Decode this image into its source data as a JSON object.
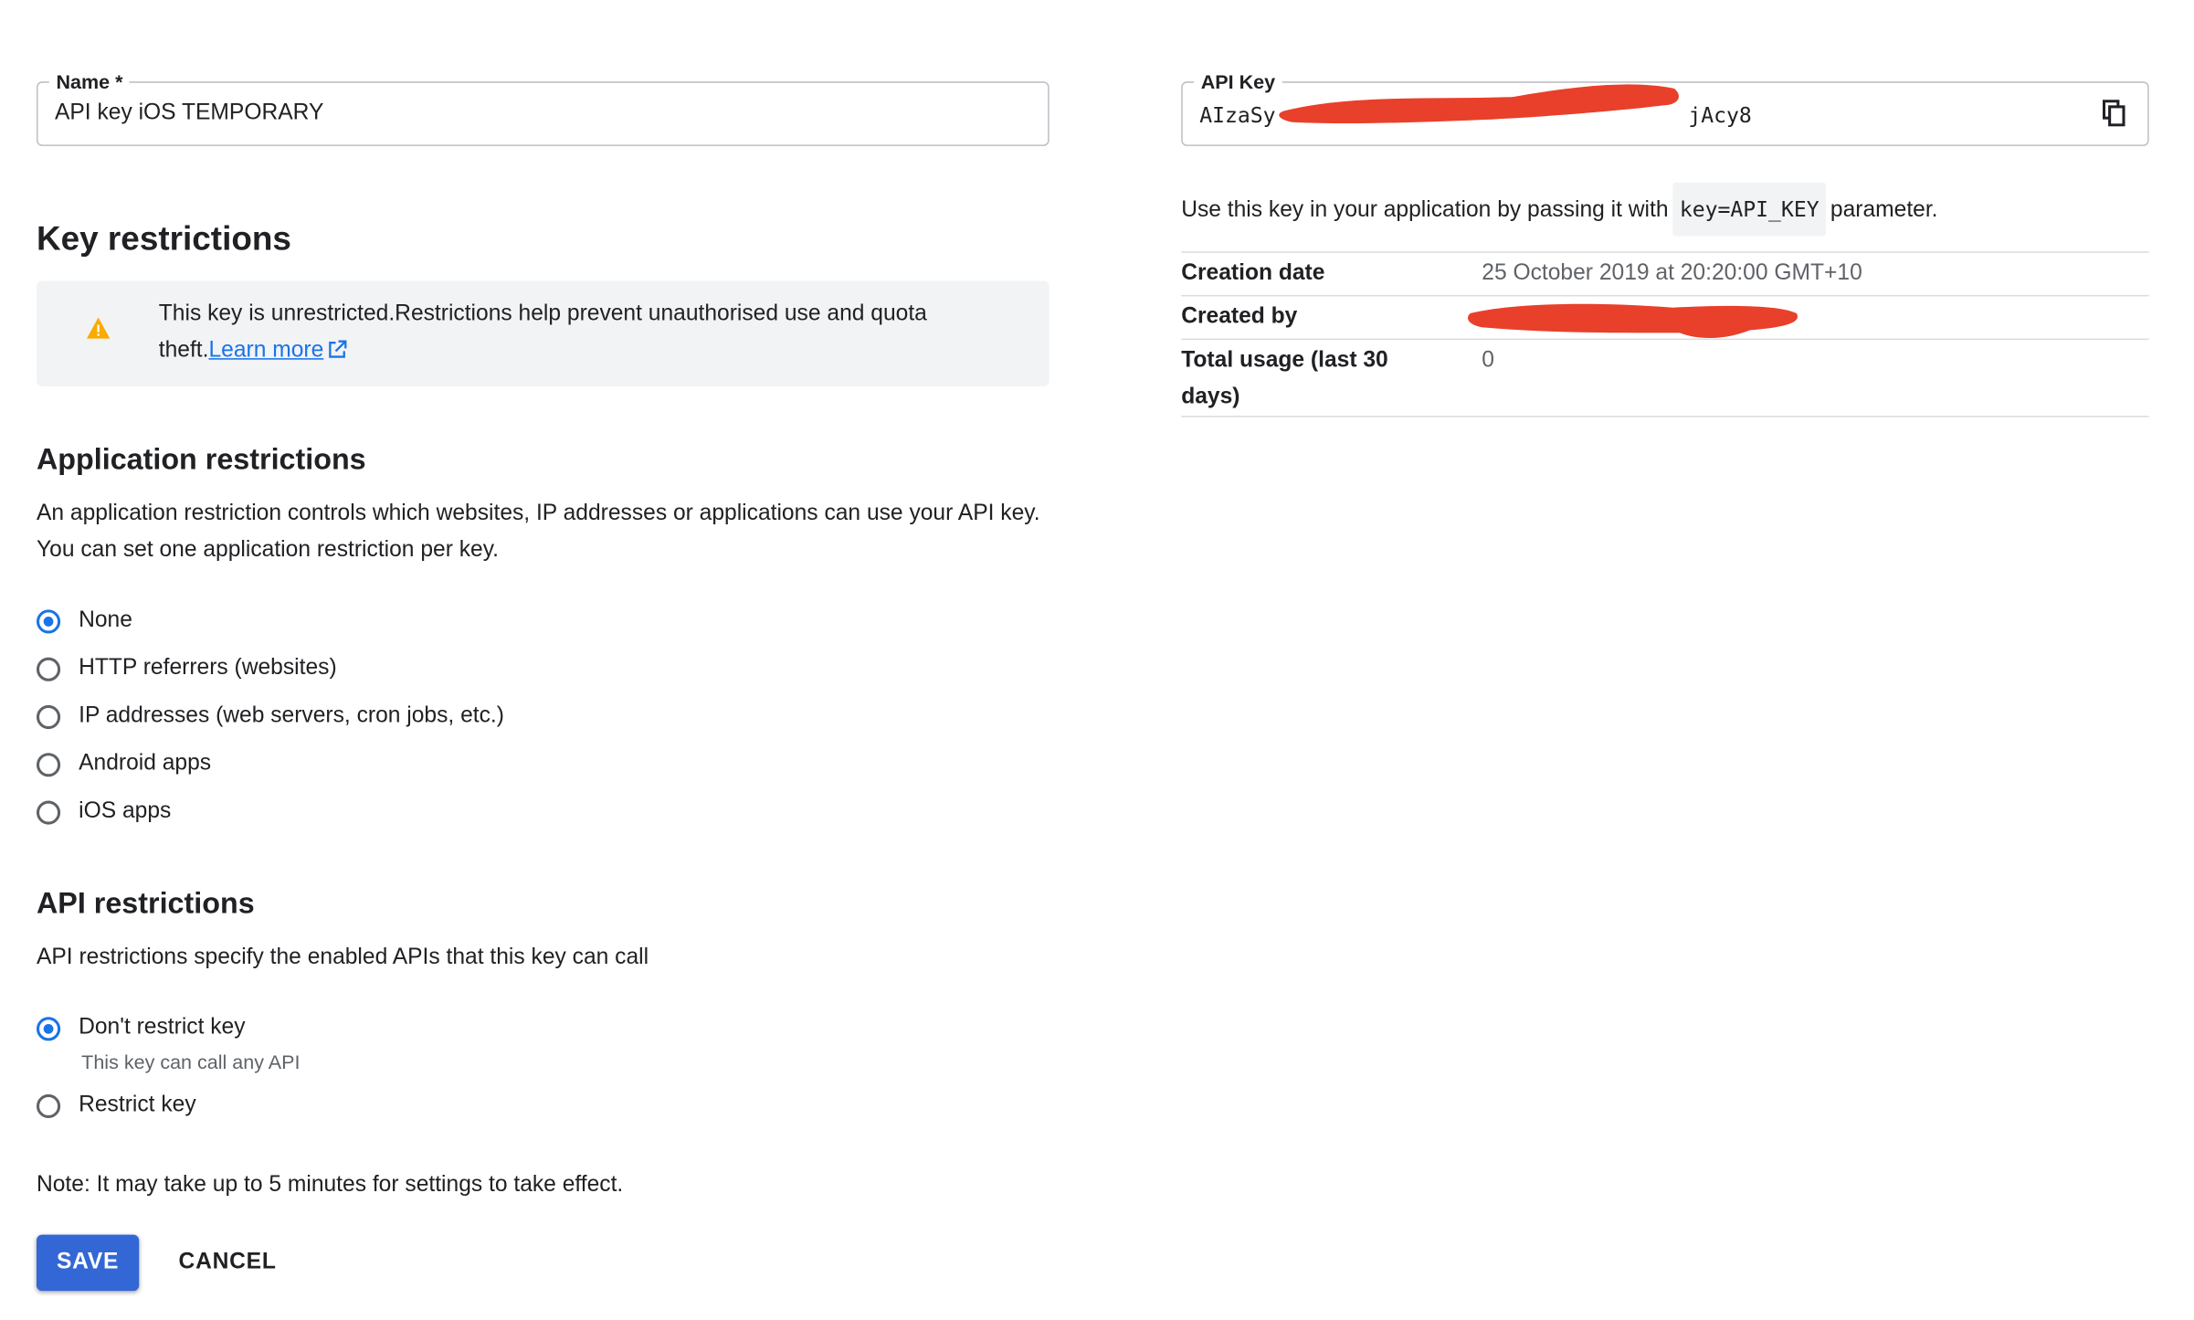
{
  "name_field": {
    "label": "Name *",
    "value": "API key iOS TEMPORARY"
  },
  "key_restrictions": {
    "heading": "Key restrictions",
    "warning_text": "This key is unrestricted.Restrictions help prevent unauthorised use and quota theft.",
    "learn_more": "Learn more",
    "warning_icon": "warning-triangle-icon",
    "warning_color": "#f9ab00"
  },
  "application_restrictions": {
    "heading": "Application restrictions",
    "description": "An application restriction controls which websites, IP addresses or applications can use your API key. You can set one application restriction per key.",
    "options": [
      {
        "label": "None",
        "checked": true
      },
      {
        "label": "HTTP referrers (websites)",
        "checked": false
      },
      {
        "label": "IP addresses (web servers, cron jobs, etc.)",
        "checked": false
      },
      {
        "label": "Android apps",
        "checked": false
      },
      {
        "label": "iOS apps",
        "checked": false
      }
    ]
  },
  "api_restrictions": {
    "heading": "API restrictions",
    "description": "API restrictions specify the enabled APIs that this key can call",
    "options": [
      {
        "label": "Don't restrict key",
        "sublabel": "This key can call any API",
        "checked": true
      },
      {
        "label": "Restrict key",
        "checked": false
      }
    ]
  },
  "note": "Note: It may take up to 5 minutes for settings to take effect.",
  "actions": {
    "save": "SAVE",
    "cancel": "CANCEL"
  },
  "api_key": {
    "label": "API Key",
    "value_start": "AIzaSy",
    "value_end": "jAcy8",
    "copy_icon": "copy-icon",
    "usage_prefix": "Use this key in your application by passing it with",
    "usage_code": "key=API_KEY",
    "usage_suffix": "parameter."
  },
  "key_info": {
    "rows": [
      {
        "key": "Creation date",
        "value": "25 October 2019 at 20:20:00 GMT+10"
      },
      {
        "key": "Created by",
        "value": ""
      },
      {
        "key": "Total usage (last 30 days)",
        "value": "0"
      }
    ]
  },
  "colors": {
    "accent": "#1a73e8",
    "save_button": "#3367d6",
    "redaction": "#e8402a"
  }
}
